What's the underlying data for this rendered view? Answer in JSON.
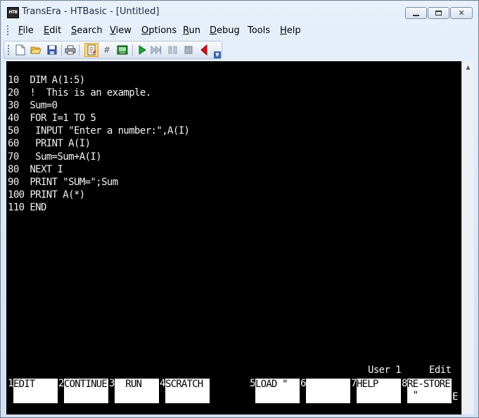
{
  "window": {
    "title": "TransEra - HTBasic - [Untitled]",
    "app_icon_text": "HTB"
  },
  "menu": [
    {
      "first": "F",
      "rest": "ile"
    },
    {
      "first": "E",
      "rest": "dit"
    },
    {
      "first": "S",
      "rest": "earch"
    },
    {
      "first": "V",
      "rest": "iew"
    },
    {
      "first": "O",
      "rest": "ptions"
    },
    {
      "first": "R",
      "rest": "un"
    },
    {
      "first": "D",
      "rest": "ebug"
    },
    {
      "first": "",
      "rest": "Tools"
    },
    {
      "first": "H",
      "rest": "elp"
    }
  ],
  "toolbar": {
    "buttons": [
      "new-file-icon",
      "open-folder-icon",
      "save-disk-icon",
      "print-icon",
      "edit-mode-icon",
      "line-number-icon",
      "console-icon",
      "run-icon",
      "step-icon",
      "pause-icon",
      "stop-icon",
      "back-icon"
    ],
    "hash_glyph": "#"
  },
  "colors": {
    "screen_bg": "#000000",
    "screen_text": "#f2f2f2",
    "softkey_bg": "#ffffff",
    "run_green": "#1aa33a",
    "back_red": "#d10f1f"
  },
  "program_lines": [
    "10  DIM A(1:5)",
    "20  !  This is an example.",
    "30  Sum=0",
    "40  FOR I=1 TO 5",
    "50   INPUT \"Enter a number:\",A(I)",
    "60   PRINT A(I)",
    "70   Sum=Sum+A(I)",
    "80  NEXT I",
    "90  PRINT \"SUM=\";Sum",
    "100 PRINT A(*)",
    "110 END"
  ],
  "status": {
    "user": "User 1",
    "mode": "Edit"
  },
  "softkeys": [
    {
      "num": "1",
      "label": "EDIT"
    },
    {
      "num": "2",
      "label": "CONTINUE"
    },
    {
      "num": "3",
      "label": "  RUN"
    },
    {
      "num": "4",
      "label": "SCRATCH"
    },
    {
      "num": "5",
      "label": "LOAD \""
    },
    {
      "num": "6",
      "label": ""
    },
    {
      "num": "7",
      "label": "HELP"
    },
    {
      "num": "8",
      "label": "RE-STORE\n \""
    }
  ],
  "corner_indicator": "E"
}
